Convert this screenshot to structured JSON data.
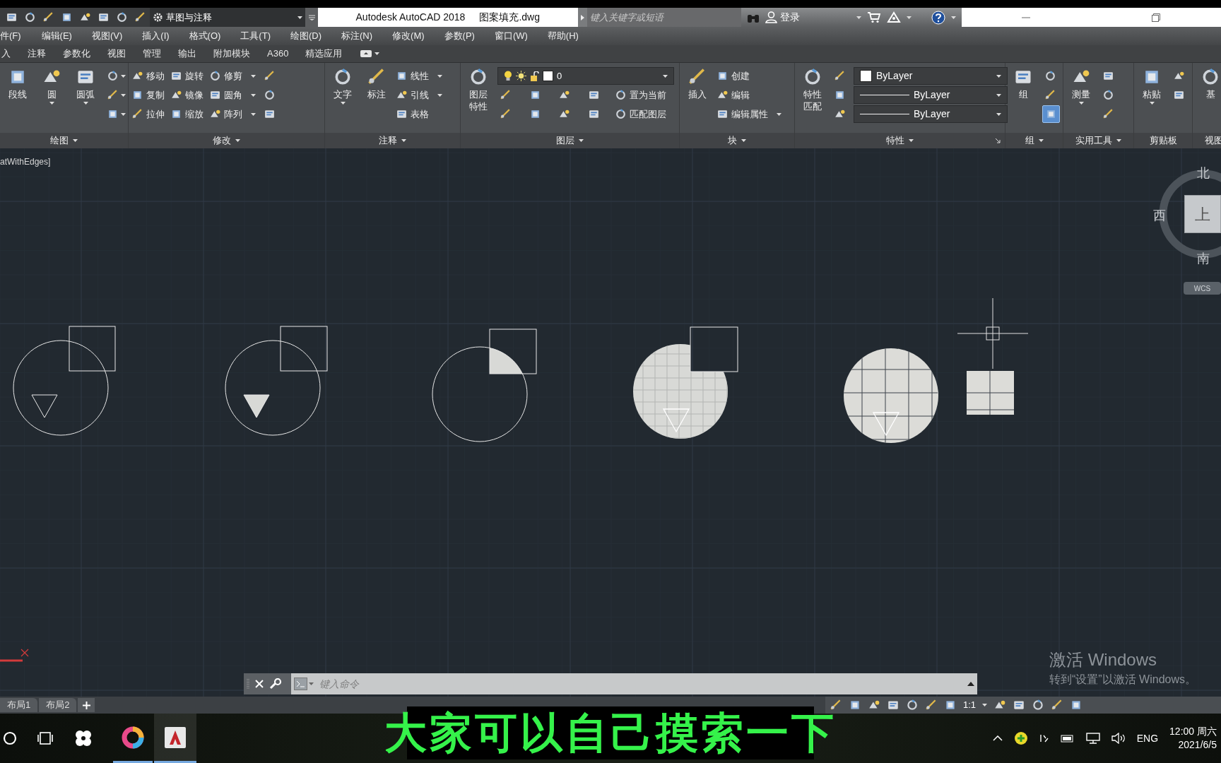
{
  "title_bar": {
    "workspace": "草图与注释",
    "app_title": "Autodesk AutoCAD 2018",
    "file_name": "图案填充.dwg",
    "search": {
      "placeholder": "键入关键字或短语"
    },
    "sign_in": "登录"
  },
  "menu": [
    "件(F)",
    "编辑(E)",
    "视图(V)",
    "插入(I)",
    "格式(O)",
    "工具(T)",
    "绘图(D)",
    "标注(N)",
    "修改(M)",
    "参数(P)",
    "窗口(W)",
    "帮助(H)"
  ],
  "ribbon_tabs": [
    "入",
    "注释",
    "参数化",
    "视图",
    "管理",
    "输出",
    "附加模块",
    "A360",
    "精选应用"
  ],
  "ribbon_panels": [
    {
      "title": "绘图",
      "menu": true,
      "large": [
        {
          "label": "段线",
          "menu": false
        },
        {
          "label": "圆",
          "menu": true
        },
        {
          "label": "圆弧",
          "menu": true
        }
      ],
      "rows": [
        [
          {
            "kind": "icon",
            "menu": true
          }
        ],
        [
          {
            "kind": "icon",
            "menu": true
          }
        ],
        [
          {
            "kind": "icon",
            "menu": true
          }
        ]
      ]
    },
    {
      "title": "修改",
      "menu": true,
      "rows": [
        [
          {
            "kind": "tool",
            "label": "移动",
            "menu": false
          },
          {
            "kind": "tool",
            "label": "旋转",
            "menu": false
          },
          {
            "kind": "tool",
            "label": "修剪",
            "menu": true
          },
          {
            "kind": "icon",
            "menu": false
          }
        ],
        [
          {
            "kind": "tool",
            "label": "复制",
            "menu": false
          },
          {
            "kind": "tool",
            "label": "镜像",
            "menu": false
          },
          {
            "kind": "tool",
            "label": "圆角",
            "menu": true
          },
          {
            "kind": "icon",
            "menu": false
          }
        ],
        [
          {
            "kind": "tool",
            "label": "拉伸",
            "menu": false
          },
          {
            "kind": "tool",
            "label": "缩放",
            "menu": false
          },
          {
            "kind": "tool",
            "label": "阵列",
            "menu": true
          },
          {
            "kind": "icon",
            "menu": false
          }
        ]
      ]
    },
    {
      "title": "注释",
      "menu": true,
      "large": [
        {
          "label": "文字",
          "menu": true
        },
        {
          "label": "标注",
          "menu": false
        }
      ],
      "rows": [
        [
          {
            "kind": "tool",
            "label": "线性",
            "menu": true
          }
        ],
        [
          {
            "kind": "tool",
            "label": "引线",
            "menu": true
          }
        ],
        [
          {
            "kind": "tool",
            "label": "表格",
            "menu": false
          }
        ]
      ]
    },
    {
      "title": "图层",
      "menu": true,
      "large": [
        {
          "label": "图层特性",
          "menu": false
        }
      ],
      "rows": [
        [
          {
            "kind": "layer-dropdown",
            "value": "0"
          }
        ],
        [
          {
            "kind": "icon",
            "menu": false
          },
          {
            "kind": "icon",
            "menu": false
          },
          {
            "kind": "icon",
            "menu": false
          },
          {
            "kind": "icon",
            "menu": false
          },
          {
            "kind": "tool",
            "label": "置为当前",
            "menu": false
          }
        ],
        [
          {
            "kind": "icon",
            "menu": false
          },
          {
            "kind": "icon",
            "menu": false
          },
          {
            "kind": "icon",
            "menu": false
          },
          {
            "kind": "icon",
            "menu": false
          },
          {
            "kind": "tool",
            "label": "匹配图层",
            "menu": false
          }
        ]
      ]
    },
    {
      "title": "块",
      "menu": true,
      "large": [
        {
          "label": "插入",
          "menu": false
        }
      ],
      "rows": [
        [
          {
            "kind": "tool",
            "label": "创建",
            "menu": false
          }
        ],
        [
          {
            "kind": "tool",
            "label": "编辑",
            "menu": false
          }
        ],
        [
          {
            "kind": "tool",
            "label": "编辑属性",
            "menu": true
          }
        ]
      ]
    },
    {
      "title": "特性",
      "menu": true,
      "launcher": true,
      "large": [
        {
          "label": "特性匹配",
          "menu": false
        }
      ],
      "rows": [
        [
          {
            "kind": "icon",
            "menu": false
          },
          {
            "kind": "property-dropdown",
            "value": "ByLayer",
            "color_swatch": true
          }
        ],
        [
          {
            "kind": "icon",
            "menu": false
          },
          {
            "kind": "property-dropdown",
            "value": "ByLayer",
            "color_swatch": false
          }
        ],
        [
          {
            "kind": "icon",
            "menu": false
          },
          {
            "kind": "property-dropdown",
            "value": "ByLayer",
            "color_swatch": false
          }
        ]
      ]
    },
    {
      "title": "组",
      "menu": true,
      "large": [
        {
          "label": "组",
          "menu": false
        }
      ],
      "rows": [
        [
          {
            "kind": "icon",
            "menu": false,
            "on": false
          }
        ],
        [
          {
            "kind": "icon",
            "menu": false,
            "on": false
          }
        ],
        [
          {
            "kind": "icon",
            "menu": false,
            "on": true
          }
        ]
      ]
    },
    {
      "title": "实用工具",
      "menu": true,
      "large": [
        {
          "label": "测量",
          "menu": true
        }
      ],
      "rows": [
        [
          {
            "kind": "icon",
            "menu": false
          }
        ],
        [
          {
            "kind": "icon",
            "menu": false
          }
        ],
        [
          {
            "kind": "icon",
            "menu": false
          }
        ]
      ]
    },
    {
      "title": "剪贴板",
      "menu": false,
      "large": [
        {
          "label": "粘贴",
          "menu": true
        }
      ],
      "rows": [
        [
          {
            "kind": "icon",
            "menu": false
          }
        ],
        [
          {
            "kind": "icon",
            "menu": false
          }
        ]
      ]
    },
    {
      "title": "视图",
      "menu": false,
      "large": [
        {
          "label": "基",
          "menu": false
        }
      ]
    }
  ],
  "viewport_label": "atWithEdges]",
  "figures": [
    {
      "kind": "outline"
    },
    {
      "kind": "solid-triangle"
    },
    {
      "kind": "overlap-fill"
    },
    {
      "kind": "fine-hatch"
    },
    {
      "kind": "grid-hatch"
    }
  ],
  "viewcube": {
    "north": "北",
    "west": "西",
    "top": "上",
    "south": "南",
    "ucs": "WCS"
  },
  "command_line": {
    "placeholder": "键入命令"
  },
  "layout_tabs": [
    "布局1",
    "布局2"
  ],
  "status_bar": {
    "scale": "1:1"
  },
  "activation": {
    "title": "激活 Windows",
    "hint": "转到“设置”以激活 Windows。"
  },
  "subtitle": "大家可以自己摸索一下",
  "taskbar": {
    "language": "ENG",
    "time": "12:00 周六",
    "date": "2021/6/5"
  }
}
